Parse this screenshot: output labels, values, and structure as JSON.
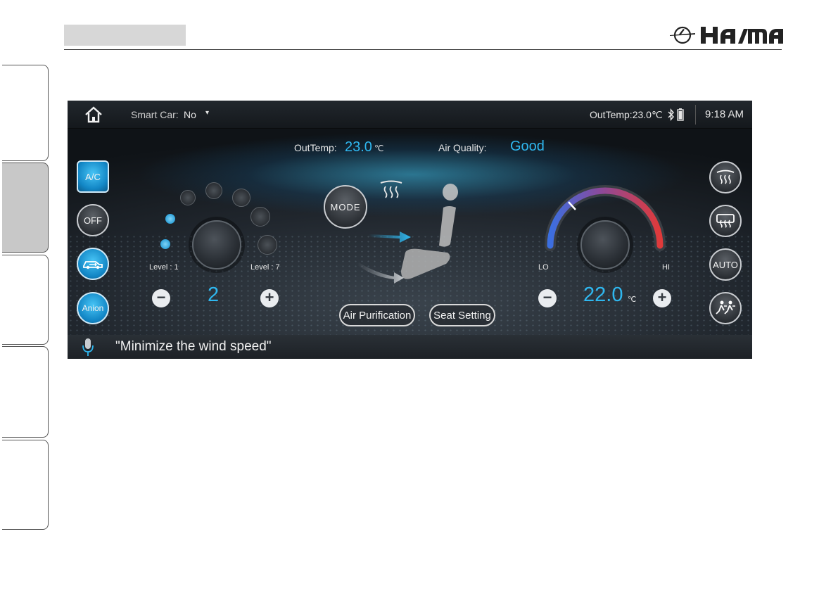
{
  "document": {
    "brand": "HAIMA"
  },
  "status_bar": {
    "smart_car_label": "Smart Car:",
    "smart_car_value": "No",
    "out_temp": "OutTemp:23.0℃",
    "time": "9:18 AM"
  },
  "climate_info": {
    "out_temp_label": "OutTemp:",
    "out_temp_value": "23.0",
    "out_temp_unit": "℃",
    "air_quality_label": "Air Quality:",
    "air_quality_value": "Good"
  },
  "left_buttons": {
    "ac": "A/C",
    "off": "OFF",
    "anion": "Anion"
  },
  "fan": {
    "level_min_label": "Level : 1",
    "level_max_label": "Level : 7",
    "level_value": "2",
    "level_number": 2,
    "level_max": 7
  },
  "mode": {
    "label": "MODE"
  },
  "bottom_buttons": {
    "air_purification": "Air Purification",
    "seat_setting": "Seat Setting"
  },
  "temperature": {
    "lo_label": "LO",
    "hi_label": "HI",
    "value": "22.0",
    "unit": "℃"
  },
  "right_buttons": {
    "auto": "AUTO"
  },
  "voice": {
    "prompt": "\"Minimize the wind speed\""
  },
  "colors": {
    "accent_blue": "#2fb7ef",
    "ac_on": "#1387c6",
    "temp_cold": "#3b6fe0",
    "temp_hot": "#e03a3a"
  }
}
